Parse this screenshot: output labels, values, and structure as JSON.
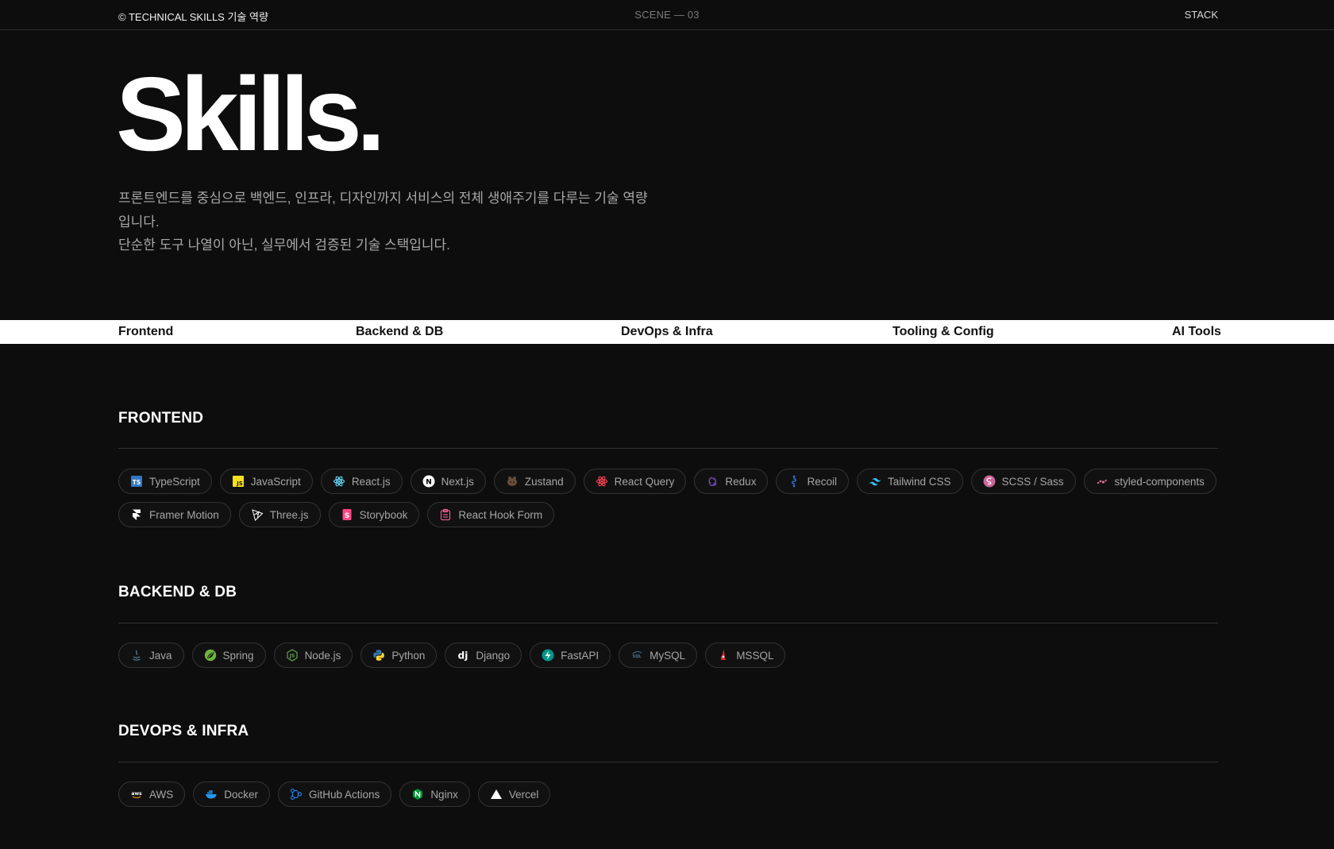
{
  "topbar": {
    "left": "© TECHNICAL SKILLS 기술 역량",
    "center": "SCENE — 03",
    "right": "STACK"
  },
  "hero": {
    "title": "Skills.",
    "desc_lines": [
      "프론트엔드를 중심으로 백엔드, 인프라, 디자인까지 서비스의 전체 생애주기를 다루는 기술 역량",
      "입니다.",
      "단순한 도구 나열이 아닌, 실무에서 검증된 기술 스택입니다."
    ]
  },
  "tabs": [
    "Frontend",
    "Backend & DB",
    "DevOps & Infra",
    "Tooling & Config",
    "AI Tools"
  ],
  "sections": [
    {
      "title": "FRONTEND",
      "items": [
        {
          "label": "TypeScript",
          "icon": "typescript-icon",
          "color": "#3178c6"
        },
        {
          "label": "JavaScript",
          "icon": "javascript-icon",
          "color": "#f7df1e"
        },
        {
          "label": "React.js",
          "icon": "react-icon",
          "color": "#61dafb"
        },
        {
          "label": "Next.js",
          "icon": "nextjs-icon",
          "color": "#ffffff"
        },
        {
          "label": "Zustand",
          "icon": "zustand-icon",
          "color": "#6b4a3a"
        },
        {
          "label": "React Query",
          "icon": "react-query-icon",
          "color": "#ff4154"
        },
        {
          "label": "Redux",
          "icon": "redux-icon",
          "color": "#764abc"
        },
        {
          "label": "Recoil",
          "icon": "recoil-icon",
          "color": "#3578e5"
        },
        {
          "label": "Tailwind CSS",
          "icon": "tailwind-icon",
          "color": "#38bdf8"
        },
        {
          "label": "SCSS / Sass",
          "icon": "sass-icon",
          "color": "#cc6699"
        },
        {
          "label": "styled-components",
          "icon": "styled-components-icon",
          "color": "#db7093"
        },
        {
          "label": "Framer Motion",
          "icon": "framer-icon",
          "color": "#ffffff"
        },
        {
          "label": "Three.js",
          "icon": "threejs-icon",
          "color": "#ffffff"
        },
        {
          "label": "Storybook",
          "icon": "storybook-icon",
          "color": "#ff4785"
        },
        {
          "label": "React Hook Form",
          "icon": "react-hook-form-icon",
          "color": "#ec5990"
        }
      ]
    },
    {
      "title": "BACKEND & DB",
      "items": [
        {
          "label": "Java",
          "icon": "java-icon",
          "color": "#5382a1"
        },
        {
          "label": "Spring",
          "icon": "spring-icon",
          "color": "#6db33f"
        },
        {
          "label": "Node.js",
          "icon": "nodejs-icon",
          "color": "#5fa04e"
        },
        {
          "label": "Python",
          "icon": "python-icon",
          "color": "#3776ab"
        },
        {
          "label": "Django",
          "icon": "django-icon",
          "color": "#ffffff"
        },
        {
          "label": "FastAPI",
          "icon": "fastapi-icon",
          "color": "#009688"
        },
        {
          "label": "MySQL",
          "icon": "mysql-icon",
          "color": "#4479a1"
        },
        {
          "label": "MSSQL",
          "icon": "mssql-icon",
          "color": "#cc2927"
        }
      ]
    },
    {
      "title": "DEVOPS & INFRA",
      "items": [
        {
          "label": "AWS",
          "icon": "aws-icon",
          "color": "#ff9900"
        },
        {
          "label": "Docker",
          "icon": "docker-icon",
          "color": "#2496ed"
        },
        {
          "label": "GitHub Actions",
          "icon": "github-actions-icon",
          "color": "#2088ff"
        },
        {
          "label": "Nginx",
          "icon": "nginx-icon",
          "color": "#009639"
        },
        {
          "label": "Vercel",
          "icon": "vercel-icon",
          "color": "#ffffff"
        }
      ]
    }
  ]
}
